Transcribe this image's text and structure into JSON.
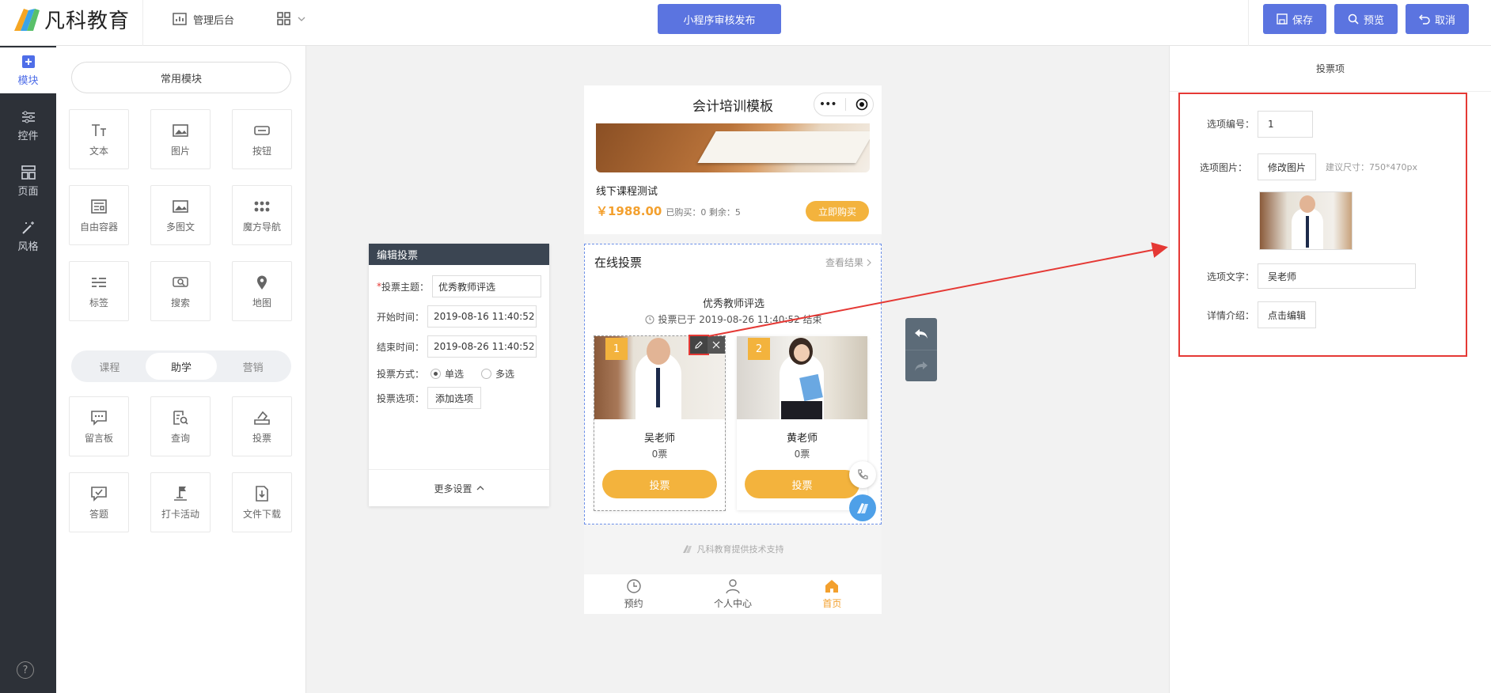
{
  "header": {
    "brand": "凡科教育",
    "admin_label": "管理后台",
    "publish_label": "小程序审核发布",
    "save_label": "保存",
    "preview_label": "预览",
    "cancel_label": "取消"
  },
  "rail": {
    "items": [
      {
        "label": "模块",
        "icon": "plus-square-icon"
      },
      {
        "label": "控件",
        "icon": "sliders-icon"
      },
      {
        "label": "页面",
        "icon": "layout-icon"
      },
      {
        "label": "风格",
        "icon": "magic-wand-icon"
      }
    ],
    "help": "?"
  },
  "panel": {
    "common_label": "常用模块",
    "common_modules": [
      "文本",
      "图片",
      "按钮",
      "自由容器",
      "多图文",
      "魔方导航",
      "标签",
      "搜索",
      "地图"
    ],
    "tabs": [
      "课程",
      "助学",
      "营销"
    ],
    "active_tab": "助学",
    "assist_modules": [
      "留言板",
      "查询",
      "投票",
      "答题",
      "打卡活动",
      "文件下载"
    ]
  },
  "edit_vote": {
    "header": "编辑投票",
    "subject_label": "投票主题：",
    "subject_value": "优秀教师评选",
    "start_label": "开始时间：",
    "start_value": "2019-08-16 11:40:52",
    "end_label": "结束时间：",
    "end_value": "2019-08-26 11:40:52",
    "mode_label": "投票方式：",
    "mode_single": "单选",
    "mode_multi": "多选",
    "options_label": "投票选项：",
    "add_option": "添加选项",
    "more_settings": "更多设置"
  },
  "phone": {
    "title": "会计培训模板",
    "course_title": "线下课程测试",
    "course_price": "￥1988.00",
    "course_meta": "已购买：0 剩余：5",
    "buy_label": "立即购买",
    "vote_title": "在线投票",
    "view_results": "查看结果",
    "vote_subject": "优秀教师评选",
    "vote_status": "投票已于 2019-08-26 11:40:52 结束",
    "candidates": [
      {
        "num": "1",
        "name": "吴老师",
        "votes": "0票",
        "btn": "投票"
      },
      {
        "num": "2",
        "name": "黄老师",
        "votes": "0票",
        "btn": "投票"
      }
    ],
    "support": "凡科教育提供技术支持",
    "footer": [
      "预约",
      "个人中心",
      "首页"
    ]
  },
  "right": {
    "header": "投票项",
    "num_label": "选项编号：",
    "num_value": "1",
    "img_label": "选项图片：",
    "modify_img": "修改图片",
    "size_hint": "建议尺寸：750*470px",
    "text_label": "选项文字：",
    "text_value": "吴老师",
    "detail_label": "详情介绍：",
    "edit_detail": "点击编辑"
  },
  "colors": {
    "accent": "#5b74e0",
    "vote": "#f3b33d",
    "red": "#e53935",
    "rail": "#2d3138"
  }
}
